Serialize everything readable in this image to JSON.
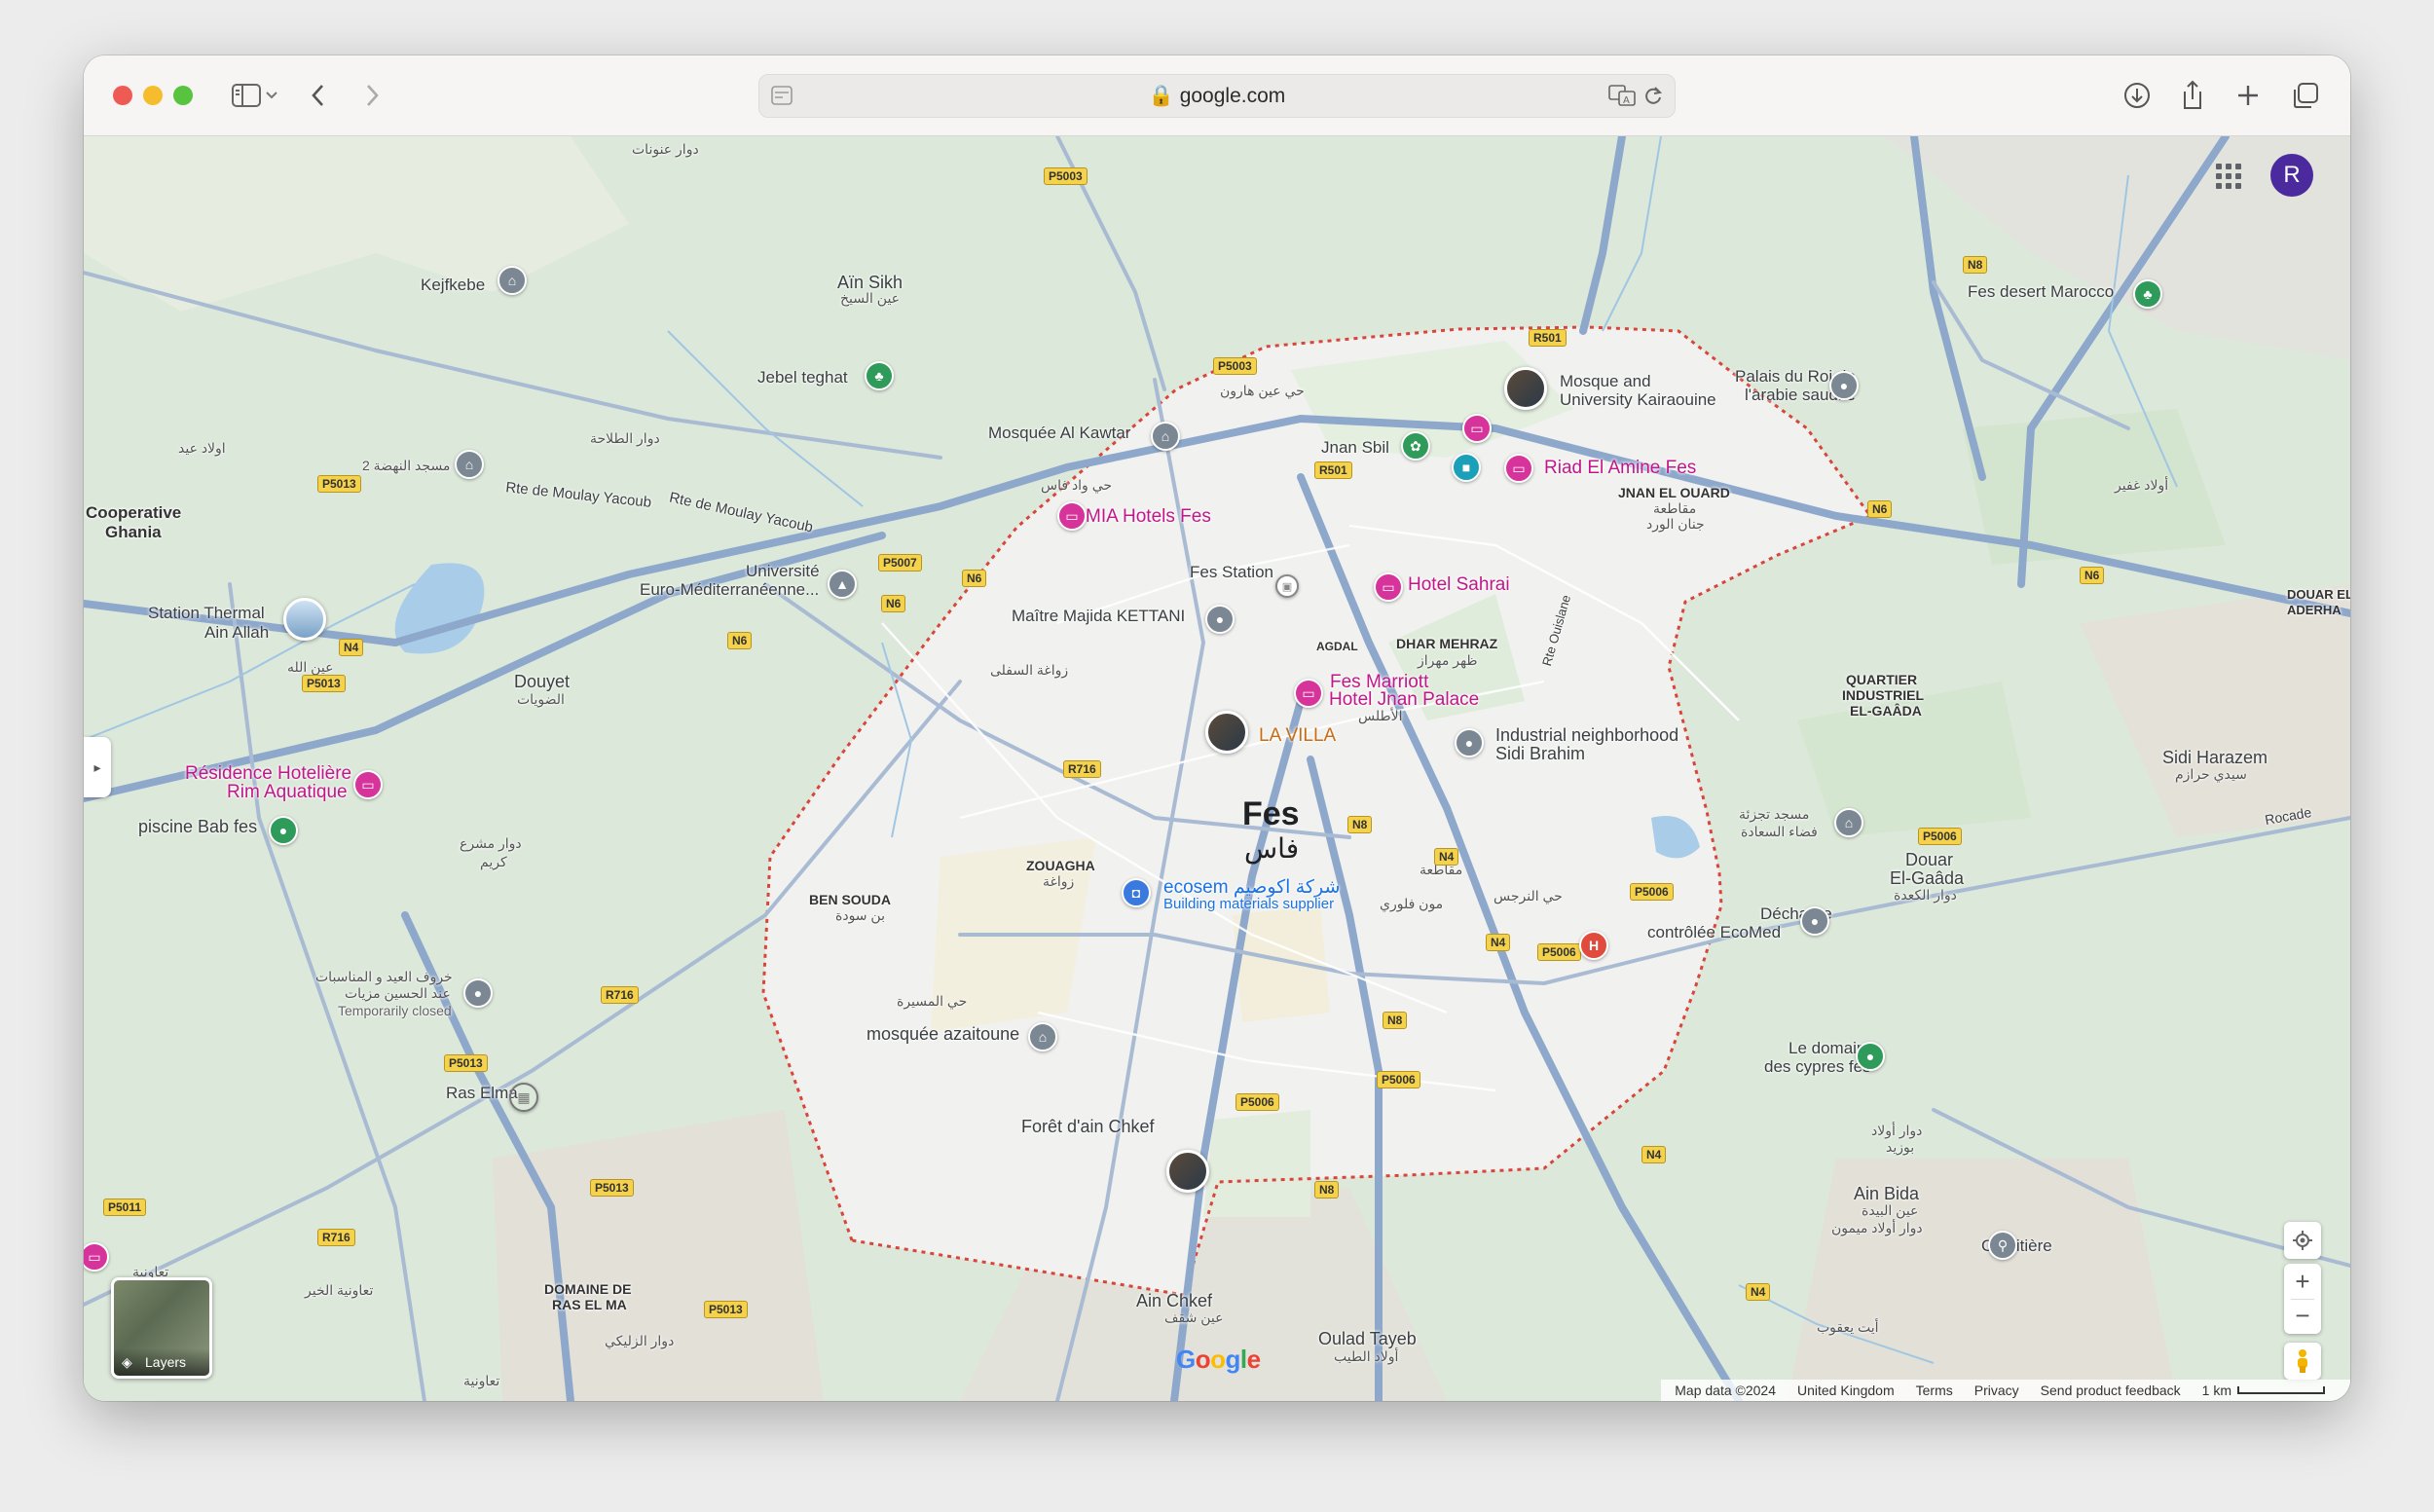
{
  "browser": {
    "url": "google.com",
    "traffic_lights": {
      "close": "#ee5b54",
      "minimize": "#f5bd2e",
      "zoom": "#58c33f"
    }
  },
  "map": {
    "city": {
      "name_en": "Fes",
      "name_ar": "فاس"
    },
    "labels": [
      {
        "text": "دوار عنونات",
        "cls": "ar"
      },
      {
        "text": "Aïn Sikh",
        "cls": ""
      },
      {
        "text": "عين السيخ",
        "cls": "ar"
      },
      {
        "text": "Kejfkebe",
        "cls": ""
      },
      {
        "text": "Jebel teghat",
        "cls": ""
      },
      {
        "text": "دوار الطلاحة",
        "cls": "ar"
      },
      {
        "text": "اولاد عيد",
        "cls": "ar"
      },
      {
        "text": "مسجد النهضة 2",
        "cls": "ar"
      },
      {
        "text": "Cooperative",
        "cls": "caps"
      },
      {
        "text": "Ghania",
        "cls": "caps"
      },
      {
        "text": "Rte de Moulay Yacoub",
        "cls": ""
      },
      {
        "text": "Rte de Moulay Yacoub",
        "cls": ""
      },
      {
        "text": "Université",
        "cls": ""
      },
      {
        "text": "Euro-Méditerranéenne...",
        "cls": ""
      },
      {
        "text": "Station Thermal",
        "cls": ""
      },
      {
        "text": "Ain Allah",
        "cls": ""
      },
      {
        "text": "عين الله",
        "cls": "ar"
      },
      {
        "text": "Douyet",
        "cls": ""
      },
      {
        "text": "الضويات",
        "cls": "ar"
      },
      {
        "text": "Résidence Hotelière",
        "cls": "pink"
      },
      {
        "text": "Rim Aquatique",
        "cls": "pink"
      },
      {
        "text": "piscine Bab fes",
        "cls": ""
      },
      {
        "text": "دوار مشرع",
        "cls": "ar"
      },
      {
        "text": "كريم",
        "cls": "ar"
      },
      {
        "text": "خروف العيد و المناسبات",
        "cls": "ar"
      },
      {
        "text": "عند الحسين مزيات",
        "cls": "ar"
      },
      {
        "text": "Temporarily closed",
        "cls": "ar"
      },
      {
        "text": "Ras Elma",
        "cls": ""
      },
      {
        "text": "تعاونية الخير",
        "cls": "ar"
      },
      {
        "text": "DOMAINE DE",
        "cls": "caps"
      },
      {
        "text": "RAS EL MA",
        "cls": "caps"
      },
      {
        "text": "دوار الزليكي",
        "cls": "ar"
      },
      {
        "text": "Mosquée Al Kawtar",
        "cls": ""
      },
      {
        "text": "حي عين هارون",
        "cls": "ar"
      },
      {
        "text": "حي واد فاس",
        "cls": "ar"
      },
      {
        "text": "Jnan Sbil",
        "cls": ""
      },
      {
        "text": "Mosque and",
        "cls": ""
      },
      {
        "text": "University Kairaouine",
        "cls": ""
      },
      {
        "text": "Riad El Amine Fes",
        "cls": "pink"
      },
      {
        "text": "MIA Hotels Fes",
        "cls": "pink"
      },
      {
        "text": "JNAN EL OUARD",
        "cls": "caps"
      },
      {
        "text": "مقاطعة",
        "cls": "ar"
      },
      {
        "text": "جنان الورد",
        "cls": "ar"
      },
      {
        "text": "Palais du Roi de",
        "cls": ""
      },
      {
        "text": "l'arabie saudite",
        "cls": ""
      },
      {
        "text": "Fes desert Marocco",
        "cls": ""
      },
      {
        "text": "أولاد غفير",
        "cls": "ar"
      },
      {
        "text": "Fes Station",
        "cls": ""
      },
      {
        "text": "Hotel Sahrai",
        "cls": "pink"
      },
      {
        "text": "Maître Majida KETTANI",
        "cls": ""
      },
      {
        "text": "زواغة السفلى",
        "cls": "ar"
      },
      {
        "text": "AGDAL",
        "cls": "caps"
      },
      {
        "text": "DHAR MEHRAZ",
        "cls": "caps"
      },
      {
        "text": "ظهر مهراز",
        "cls": "ar"
      },
      {
        "text": "Rte Ouislane",
        "cls": ""
      },
      {
        "text": "Fes Marriott",
        "cls": "pink"
      },
      {
        "text": "Hotel Jnan Palace",
        "cls": "pink"
      },
      {
        "text": "الأطلس",
        "cls": "ar"
      },
      {
        "text": "LA VILLA",
        "cls": "pink"
      },
      {
        "text": "Industrial neighborhood",
        "cls": ""
      },
      {
        "text": "Sidi Brahim",
        "cls": ""
      },
      {
        "text": "QUARTIER",
        "cls": "caps"
      },
      {
        "text": "INDUSTRIEL",
        "cls": "caps"
      },
      {
        "text": "EL-GAÂDA",
        "cls": "caps"
      },
      {
        "text": "ZOUAGHA",
        "cls": "caps"
      },
      {
        "text": "زواغة",
        "cls": "ar"
      },
      {
        "text": "BEN SOUDA",
        "cls": "caps"
      },
      {
        "text": "بن سودة",
        "cls": "ar"
      },
      {
        "text": "ecosem شركة اكوصيم",
        "cls": "blue"
      },
      {
        "text": "Building materials supplier",
        "cls": "blue"
      },
      {
        "text": "مقاطعة",
        "cls": "ar"
      },
      {
        "text": "مون فلوري",
        "cls": "ar"
      },
      {
        "text": "حي النرجس",
        "cls": "ar"
      },
      {
        "text": "مسجد تجزئة",
        "cls": "ar"
      },
      {
        "text": "فضاء السعادة",
        "cls": "ar"
      },
      {
        "text": "Douar",
        "cls": ""
      },
      {
        "text": "El-Gaâda",
        "cls": ""
      },
      {
        "text": "دوار الكعدة",
        "cls": "ar"
      },
      {
        "text": "Décharge",
        "cls": ""
      },
      {
        "text": "contrôlée EcoMed",
        "cls": ""
      },
      {
        "text": "Sidi Harazem",
        "cls": ""
      },
      {
        "text": "سيدي حرازم",
        "cls": "ar"
      },
      {
        "text": "حي المسيرة",
        "cls": "ar"
      },
      {
        "text": "mosquée azaitoune",
        "cls": ""
      },
      {
        "text": "Forêt d'ain Chkef",
        "cls": ""
      },
      {
        "text": "Le domaine",
        "cls": ""
      },
      {
        "text": "des cypres fes",
        "cls": ""
      },
      {
        "text": "دوار أولاد",
        "cls": "ar"
      },
      {
        "text": "بوزيد",
        "cls": "ar"
      },
      {
        "text": "Ain Bida",
        "cls": ""
      },
      {
        "text": "عين البيدة",
        "cls": "ar"
      },
      {
        "text": "دوار أولاد ميمون",
        "cls": "ar"
      },
      {
        "text": "Cemitière",
        "cls": ""
      },
      {
        "text": "Ain Chkef",
        "cls": ""
      },
      {
        "text": "عين شقف",
        "cls": "ar"
      },
      {
        "text": "Oulad Tayeb",
        "cls": ""
      },
      {
        "text": "أولاد الطيب",
        "cls": "ar"
      },
      {
        "text": "أيت يعقوب",
        "cls": "ar"
      },
      {
        "text": "DOUAR EL",
        "cls": "caps"
      },
      {
        "text": "ADERHA",
        "cls": "caps"
      },
      {
        "text": "Rocade",
        "cls": ""
      },
      {
        "text": "تعاونية",
        "cls": "ar"
      },
      {
        "text": "تعاونية",
        "cls": "ar"
      }
    ],
    "road_shields": [
      "P5003",
      "P5003",
      "P5013",
      "P5007",
      "N6",
      "N4",
      "N6",
      "N6",
      "P5013",
      "R501",
      "R501",
      "N8",
      "R716",
      "N8",
      "N4",
      "P5006",
      "N4",
      "P5006",
      "N8",
      "P5006",
      "P5006",
      "N8",
      "N4",
      "P5006",
      "N4",
      "P5013",
      "R716",
      "P5013",
      "P5011",
      "R716",
      "P5013",
      "N6",
      "N6"
    ],
    "user_avatar": "R",
    "google_logo": "Google",
    "layers_label": "Layers",
    "footer": {
      "map_data": "Map data ©2024",
      "region": "United Kingdom",
      "terms": "Terms",
      "privacy": "Privacy",
      "feedback": "Send product feedback",
      "scale": "1 km"
    }
  }
}
